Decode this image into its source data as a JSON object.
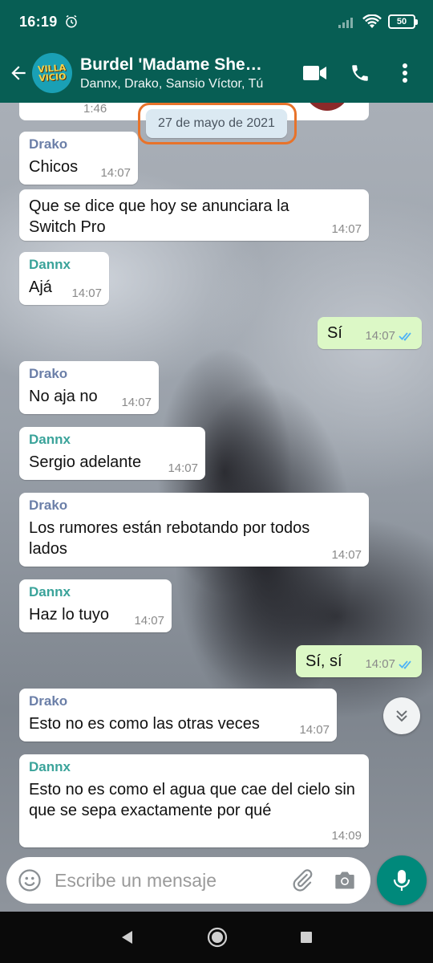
{
  "status_bar": {
    "time": "16:19",
    "battery": "50"
  },
  "header": {
    "avatar_text": "VILLA VICIO",
    "title": "Burdel 'Madame She…",
    "subtitle": "Dannx, Drako, Sansio Víctor, Tú"
  },
  "chat": {
    "partial_time": "1:46",
    "date": "27 de mayo de 2021",
    "messages": [
      {
        "sender": "Drako",
        "text": "Chicos",
        "time": "14:07"
      },
      {
        "sender": "",
        "text": "Que se dice que hoy se anunciara la Switch Pro",
        "time": "14:07"
      },
      {
        "sender": "Dannx",
        "text": "Ajá",
        "time": "14:07"
      },
      {
        "sender": "",
        "text": "Sí",
        "time": "14:07",
        "outgoing": true
      },
      {
        "sender": "Drako",
        "text": "No aja no",
        "time": "14:07"
      },
      {
        "sender": "Dannx",
        "text": "Sergio adelante",
        "time": "14:07"
      },
      {
        "sender": "Drako",
        "text": "Los rumores están rebotando por todos lados",
        "time": "14:07"
      },
      {
        "sender": "Dannx",
        "text": "Haz lo tuyo",
        "time": "14:07"
      },
      {
        "sender": "",
        "text": "Sí, sí",
        "time": "14:07",
        "outgoing": true
      },
      {
        "sender": "Drako",
        "text": "Esto no es como las otras veces",
        "time": "14:07"
      },
      {
        "sender": "Dannx",
        "text": "Esto no es como el agua que cae del cielo sin que se sepa exactamente por qué",
        "time": "14:09"
      }
    ]
  },
  "composer": {
    "placeholder": "Escribe un mensaje"
  },
  "colors": {
    "header": "#075e54",
    "outgoing_bubble": "#dcf8c6",
    "mic_button": "#00897b",
    "date_highlight": "#e8732a",
    "drako": "#6b7fa8",
    "dannx": "#3aa39a",
    "read_tick": "#4fb3f6"
  }
}
